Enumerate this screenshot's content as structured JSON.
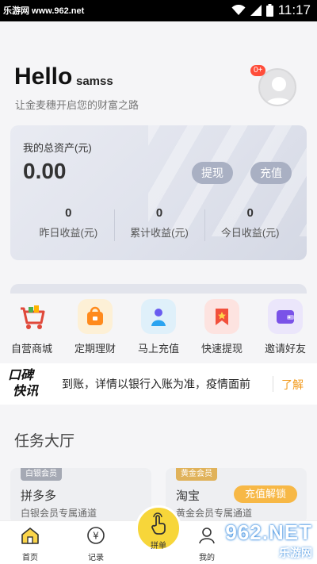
{
  "status_bar": {
    "watermark": "乐游网 www.962.net",
    "time": "11:17"
  },
  "header": {
    "greeting": "Hello",
    "username": "samss",
    "subtitle": "让金麦穗开启您的财富之路",
    "notification_badge": "0+"
  },
  "asset_card": {
    "label": "我的总资产(元)",
    "total": "0.00",
    "withdraw_label": "提现",
    "recharge_label": "充值",
    "stats": [
      {
        "value": "0",
        "label": "昨日收益(元)"
      },
      {
        "value": "0",
        "label": "累计收益(元)"
      },
      {
        "value": "0",
        "label": "今日收益(元)"
      }
    ]
  },
  "menu": [
    {
      "label": "自营商城",
      "icon": "shopping-cart-icon"
    },
    {
      "label": "定期理财",
      "icon": "wallet-bag-icon"
    },
    {
      "label": "马上充值",
      "icon": "recharge-person-icon"
    },
    {
      "label": "快速提现",
      "icon": "withdraw-ribbon-icon"
    },
    {
      "label": "邀请好友",
      "icon": "invite-wallet-icon"
    }
  ],
  "news": {
    "logo_line1": "口碑",
    "logo_line2": "快讯",
    "text": "到账，详情以银行入账为准，疫情面前",
    "more_label": "了解"
  },
  "section_title": "任务大厅",
  "tasks": [
    {
      "tag": "白银会员",
      "name": "拼多多",
      "desc": "白银会员专属通道",
      "button": ""
    },
    {
      "tag": "黄金会员",
      "name": "淘宝",
      "desc": "黄金会员专属通道",
      "button": "充值解锁"
    }
  ],
  "bottom_nav": {
    "home": "首页",
    "records": "记录",
    "center": "拼单",
    "mine": "我的"
  },
  "watermark_br": {
    "big": "962.NET",
    "small": "乐游网"
  },
  "colors": {
    "accent_yellow": "#f7d63a",
    "accent_orange": "#f29a1c",
    "pill_gray": "#a9b0c3",
    "badge_red": "#ff4d3a"
  }
}
